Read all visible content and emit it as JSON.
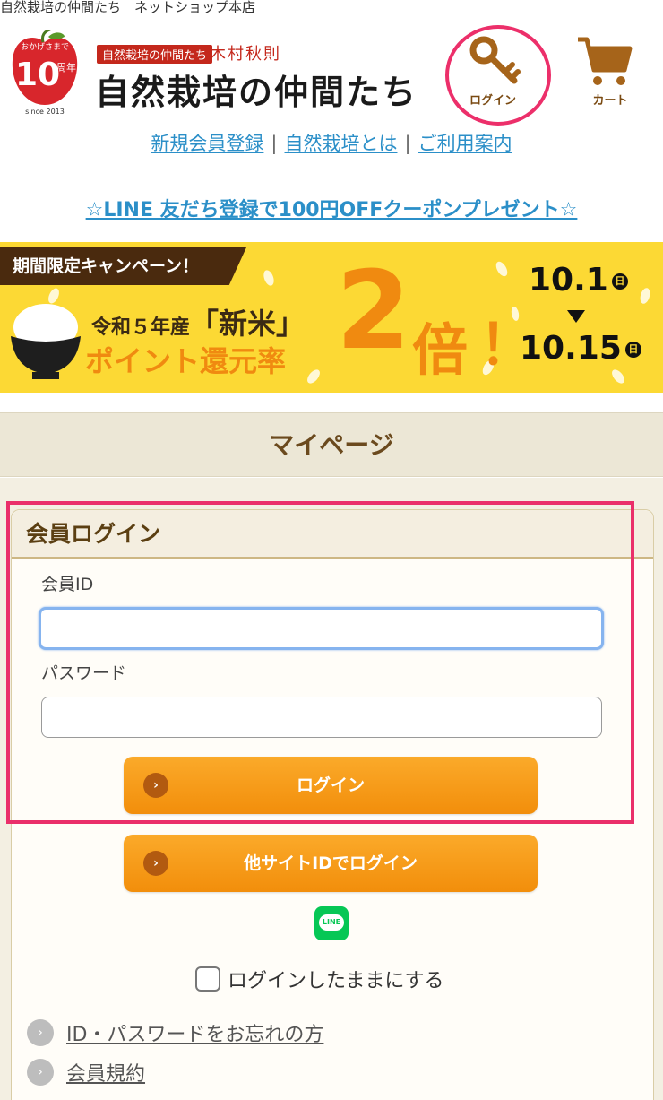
{
  "site_title": "自然栽培の仲間たち　ネットショップ本店",
  "header": {
    "anniversary": {
      "top": "おかげさまで",
      "number": "10",
      "suffix": "周年",
      "since": "since 2013"
    },
    "brand_sub_badge": "自然栽培の仲間たち",
    "brand_sub": "木村秋則",
    "brand_main": "自然栽培の仲間たち",
    "login_label": "ログイン",
    "cart_label": "カート"
  },
  "nav": {
    "items": [
      "新規会員登録",
      "自然栽培とは",
      "ご利用案内"
    ],
    "separator": "|"
  },
  "line_promo": "☆LINE 友だち登録で100円OFFクーポンプレゼント☆",
  "banner": {
    "badge": "期間限定キャンペーン！",
    "line1_prefix": "令和５年産",
    "line1_main": "「新米」",
    "line2": "ポイント還元率",
    "multiplier": "2",
    "multiplier_suffix": "倍",
    "exclaim": "！",
    "date_start": "10.1",
    "date_end": "10.15",
    "day_mark": "日"
  },
  "page_title": "マイページ",
  "login_panel": {
    "title": "会員ログイン",
    "id_label": "会員ID",
    "id_value": "",
    "password_label": "パスワード",
    "password_value": "",
    "login_button": "ログイン",
    "other_login_button": "他サイトIDでログイン",
    "line_badge": "LINE",
    "keep_logged_in": "ログインしたままにする",
    "links": [
      "ID・パスワードをお忘れの方",
      "会員規約"
    ]
  },
  "colors": {
    "accent_orange": "#f28e0b",
    "link_blue": "#2b8fc8",
    "highlight_pink": "#ea2f6a",
    "banner_yellow": "#fcd934",
    "line_green": "#06c755"
  }
}
